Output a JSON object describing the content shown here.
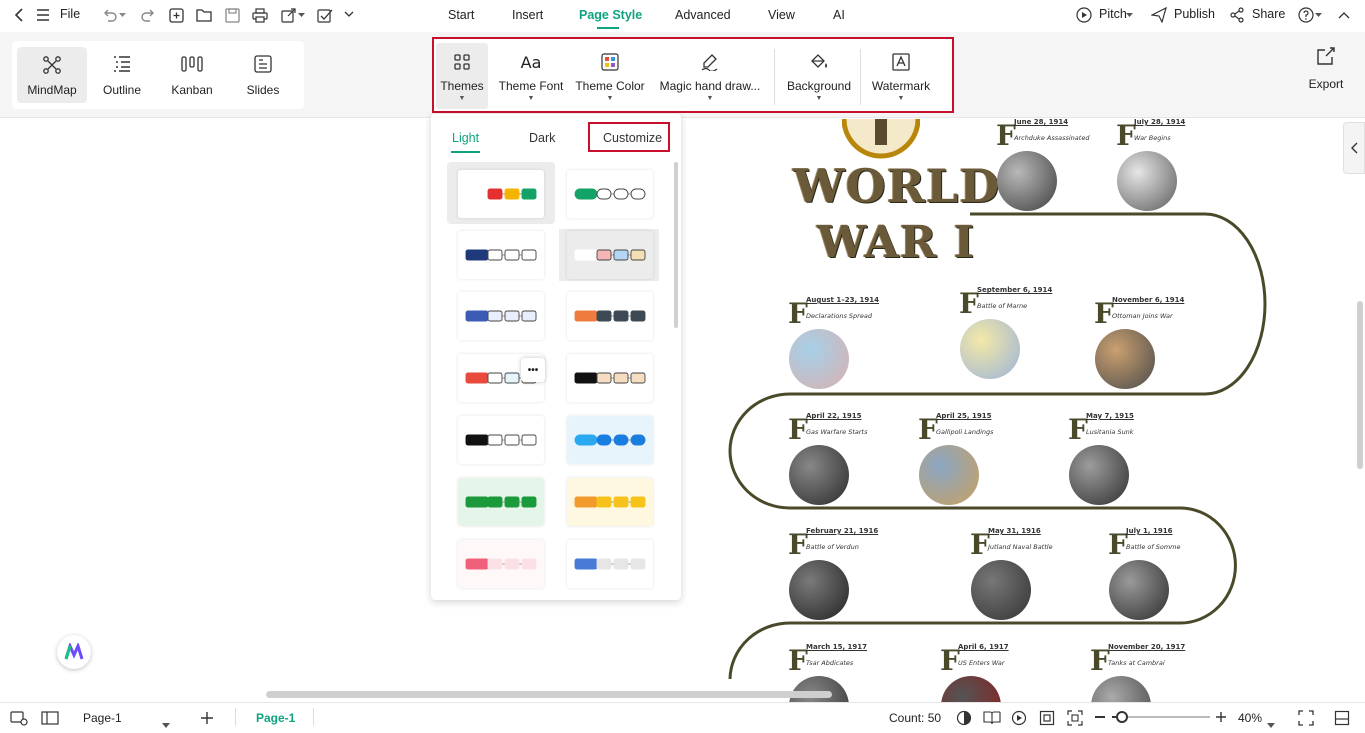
{
  "app": {
    "brand_color": "#10a37f",
    "highlight_color": "#c8102e"
  },
  "topbar": {
    "file_label": "File",
    "menu": [
      "Start",
      "Insert",
      "Page Style",
      "Advanced",
      "View",
      "AI"
    ],
    "active_menu": "Page Style",
    "pitch_label": "Pitch",
    "publish_label": "Publish",
    "share_label": "Share"
  },
  "views": {
    "mindmap": "MindMap",
    "outline": "Outline",
    "kanban": "Kanban",
    "slides": "Slides",
    "selected": "MindMap"
  },
  "page_style": {
    "themes": "Themes",
    "theme_font": "Theme Font",
    "theme_color": "Theme Color",
    "magic": "Magic hand draw...",
    "background": "Background",
    "watermark": "Watermark"
  },
  "export_label": "Export",
  "theme_panel": {
    "tabs": [
      "Light",
      "Dark",
      "Customize"
    ],
    "active_tab": "Light",
    "more_label": "•••",
    "icons": [
      "flower-icon",
      "grid-icon"
    ]
  },
  "map": {
    "title_line1": "WORLD",
    "title_line2": "WAR I",
    "line_color": "#4a4a2a",
    "events": [
      {
        "date": "June 28, 1914",
        "title": "Archduke Assassinated"
      },
      {
        "date": "July 28, 1914",
        "title": "War Begins"
      },
      {
        "date": "August 1–23, 1914",
        "title": "Declarations Spread"
      },
      {
        "date": "September 6, 1914",
        "title": "Battle of Marne"
      },
      {
        "date": "November 6, 1914",
        "title": "Ottoman Joins War"
      },
      {
        "date": "April 22, 1915",
        "title": "Gas Warfare Starts"
      },
      {
        "date": "April 25, 1915",
        "title": "Gallipoli Landings"
      },
      {
        "date": "May 7, 1915",
        "title": "Lusitania Sunk"
      },
      {
        "date": "February 21, 1916",
        "title": "Battle of Verdun"
      },
      {
        "date": "May 31, 1916",
        "title": "Jutland Naval Battle"
      },
      {
        "date": "July 1, 1916",
        "title": "Battle of Somme"
      },
      {
        "date": "March 15, 1917",
        "title": "Tsar Abdicates"
      },
      {
        "date": "April 6, 1917",
        "title": "US Enters War"
      },
      {
        "date": "November 20, 1917",
        "title": "Tanks at Cambrai"
      }
    ]
  },
  "statusbar": {
    "page_select": "Page-1",
    "page_tab": "Page-1",
    "count": "Count: 50",
    "zoom_level": 40,
    "zoom": "40%"
  }
}
